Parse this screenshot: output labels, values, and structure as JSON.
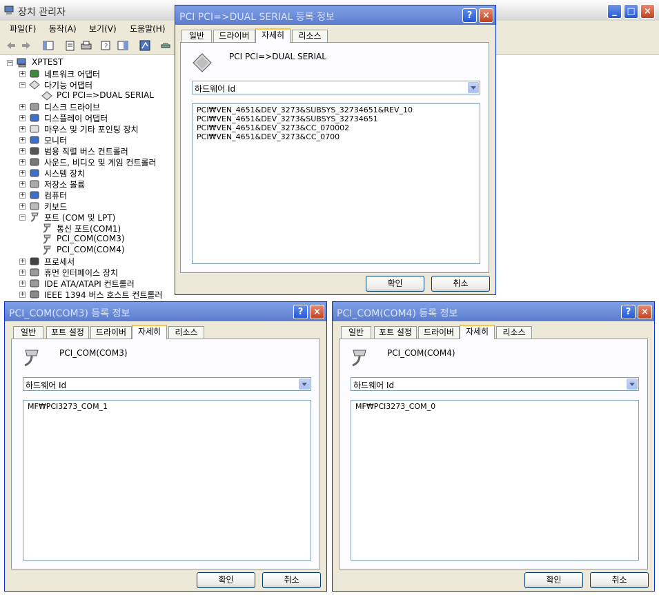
{
  "main": {
    "title": "장치 관리자",
    "menu": [
      "파일(F)",
      "동작(A)",
      "보기(V)",
      "도움말(H)"
    ],
    "tree": {
      "root": "XPTEST",
      "items": [
        {
          "label": "네트워크 어댑터",
          "icon": "network-adapter-icon",
          "level": 1
        },
        {
          "label": "다기능 어댑터",
          "icon": "multifunction-adapter-icon",
          "level": 1
        },
        {
          "label": "PCI PCI=>DUAL SERIAL",
          "icon": "multifunction-device-icon",
          "level": 2
        },
        {
          "label": "디스크 드라이브",
          "icon": "disk-drive-icon",
          "level": 1
        },
        {
          "label": "디스플레이 어댑터",
          "icon": "display-adapter-icon",
          "level": 1
        },
        {
          "label": "마우스 및 기타 포인팅 장치",
          "icon": "mouse-icon",
          "level": 1
        },
        {
          "label": "모니터",
          "icon": "monitor-icon",
          "level": 1
        },
        {
          "label": "범용 직렬 버스 컨트롤러",
          "icon": "usb-icon",
          "level": 1
        },
        {
          "label": "사운드, 비디오 및 게임 컨트롤러",
          "icon": "sound-icon",
          "level": 1
        },
        {
          "label": "시스템 장치",
          "icon": "system-device-icon",
          "level": 1
        },
        {
          "label": "저장소 볼륨",
          "icon": "storage-volume-icon",
          "level": 1
        },
        {
          "label": "컴퓨터",
          "icon": "computer-icon",
          "level": 1
        },
        {
          "label": "키보드",
          "icon": "keyboard-icon",
          "level": 1
        },
        {
          "label": "포트 (COM 및 LPT)",
          "icon": "port-icon",
          "level": 1
        },
        {
          "label": "통신 포트(COM1)",
          "icon": "port-icon",
          "level": 2
        },
        {
          "label": "PCI_COM(COM3)",
          "icon": "port-icon",
          "level": 2
        },
        {
          "label": "PCI_COM(COM4)",
          "icon": "port-icon",
          "level": 2
        },
        {
          "label": "프로세서",
          "icon": "processor-icon",
          "level": 1
        },
        {
          "label": "휴먼 인터페이스 장치",
          "icon": "hid-icon",
          "level": 1
        },
        {
          "label": "IDE ATA/ATAPI 컨트롤러",
          "icon": "ide-icon",
          "level": 1
        },
        {
          "label": "IEEE 1394 버스 호스트 컨트롤러",
          "icon": "ieee1394-icon",
          "level": 1
        }
      ]
    }
  },
  "dialog_pci": {
    "title": "PCI PCI=>DUAL SERIAL 등록 정보",
    "tabs": [
      "일반",
      "드라이버",
      "자세히",
      "리소스"
    ],
    "active_tab": "자세히",
    "device_name": "PCI PCI=>DUAL SERIAL",
    "property": "하드웨어 Id",
    "values": [
      "PCI₩VEN_4651&DEV_3273&SUBSYS_32734651&REV_10",
      "PCI₩VEN_4651&DEV_3273&SUBSYS_32734651",
      "PCI₩VEN_4651&DEV_3273&CC_070002",
      "PCI₩VEN_4651&DEV_3273&CC_0700"
    ],
    "ok": "확인",
    "cancel": "취소"
  },
  "dialog_com3": {
    "title": "PCI_COM(COM3) 등록 정보",
    "tabs": [
      "일반",
      "포트 설정",
      "드라이버",
      "자세히",
      "리소스"
    ],
    "active_tab": "자세히",
    "device_name": "PCI_COM(COM3)",
    "property": "하드웨어 Id",
    "values": [
      "MF₩PCI3273_COM_1"
    ],
    "ok": "확인",
    "cancel": "취소"
  },
  "dialog_com4": {
    "title": "PCI_COM(COM4) 등록 정보",
    "tabs": [
      "일반",
      "포트 설정",
      "드라이버",
      "자세히",
      "리소스"
    ],
    "active_tab": "자세히",
    "device_name": "PCI_COM(COM4)",
    "property": "하드웨어 Id",
    "values": [
      "MF₩PCI3273_COM_0"
    ],
    "ok": "확인",
    "cancel": "취소"
  },
  "colors": {
    "title_active": "#0553e0",
    "title_inactive": "#7c9ee9",
    "tab_accent": "#ffc83c",
    "window_bg": "#ece9d8"
  }
}
